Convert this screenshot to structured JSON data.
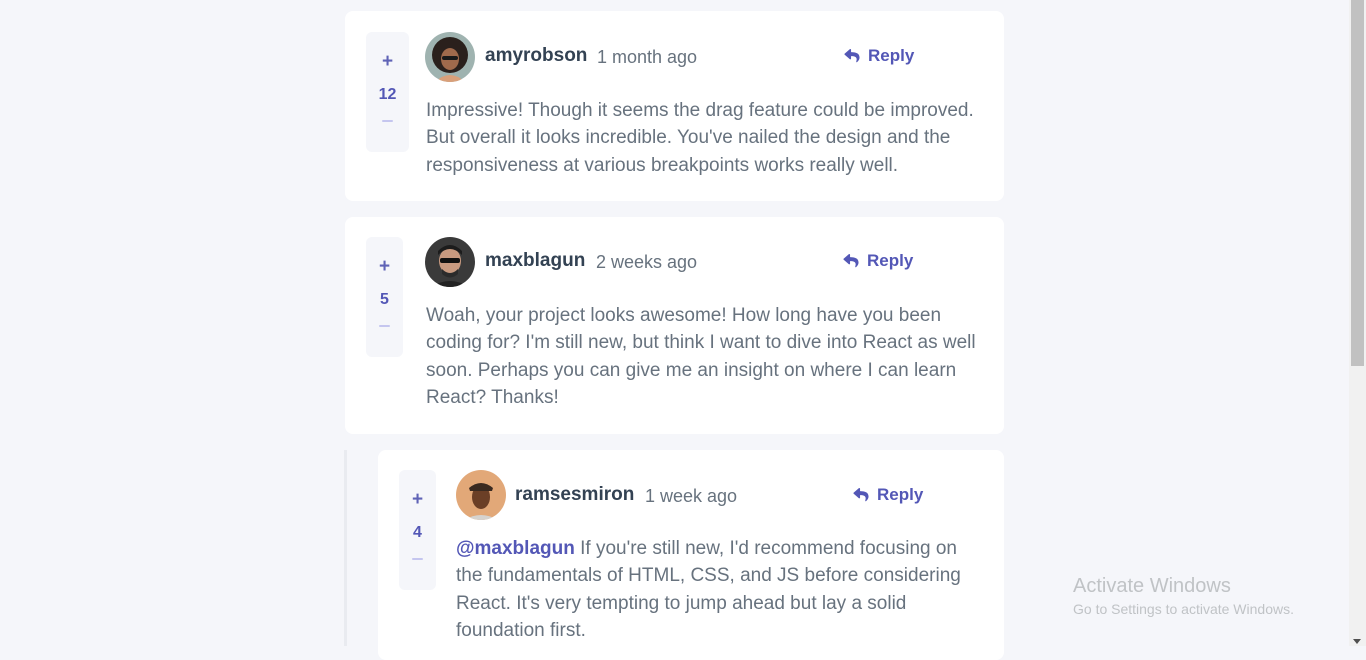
{
  "comments": [
    {
      "score": "12",
      "plus": "+",
      "username": "amyrobson",
      "time": "1 month ago",
      "reply_label": "Reply",
      "content": "Impressive! Though it seems the drag feature could be improved. But overall it looks incredible. You've nailed the design and the responsiveness at various breakpoints works really well."
    },
    {
      "score": "5",
      "plus": "+",
      "username": "maxblagun",
      "time": "2 weeks ago",
      "reply_label": "Reply",
      "content": "Woah, your project looks awesome! How long have you been coding for? I'm still new, but think I want to dive into React as well soon. Perhaps you can give me an insight on where I can learn React? Thanks!"
    }
  ],
  "replies": [
    {
      "score": "4",
      "plus": "+",
      "username": "ramsesmiron",
      "time": "1 week ago",
      "reply_label": "Reply",
      "mention": "@maxblagun",
      "content": " If you're still new, I'd recommend focusing on the fundamentals of HTML, CSS, and JS before considering React. It's very tempting to jump ahead but lay a solid foundation first."
    }
  ],
  "watermark": {
    "title": "Activate Windows",
    "subtitle": "Go to Settings to activate Windows."
  },
  "colors": {
    "accent": "#5357b6",
    "background": "#f5f6fa",
    "text": "#67727e",
    "heading": "#334253"
  }
}
